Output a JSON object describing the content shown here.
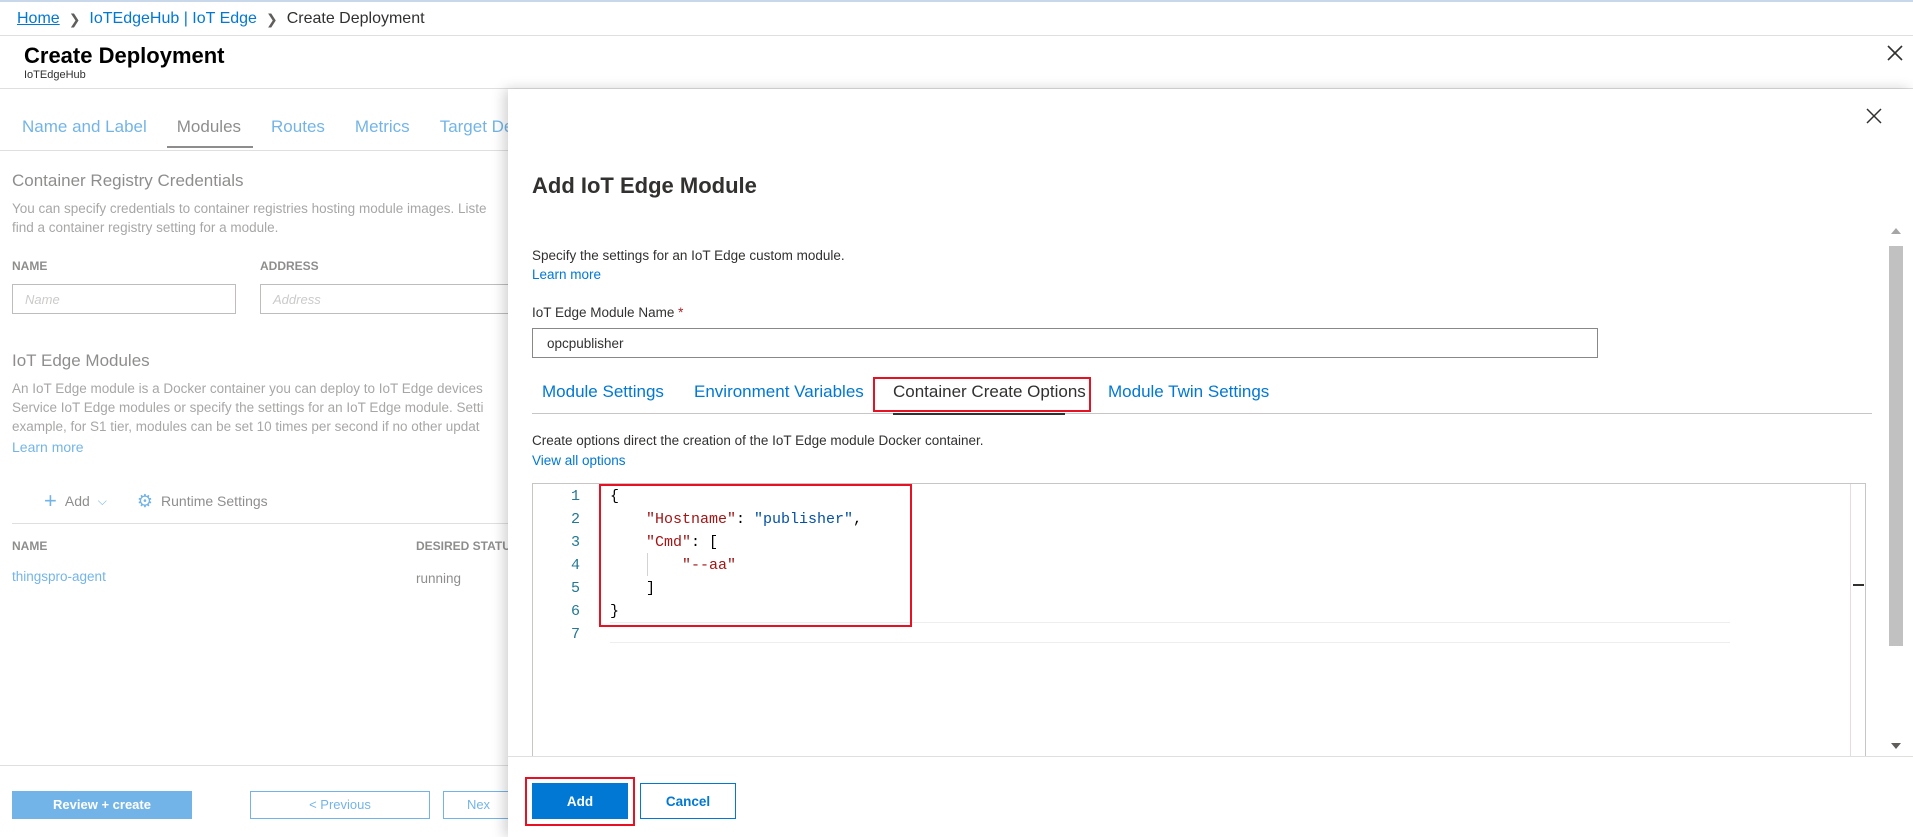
{
  "breadcrumb": {
    "home": "Home",
    "hub": "IoTEdgeHub | IoT Edge",
    "current": "Create Deployment"
  },
  "blade": {
    "title": "Create Deployment",
    "subtitle": "IoTEdgeHub"
  },
  "background": {
    "tabs": [
      "Name and Label",
      "Modules",
      "Routes",
      "Metrics",
      "Target De"
    ],
    "active_tab": "Modules",
    "registry": {
      "heading": "Container Registry Credentials",
      "desc_line1": "You can specify credentials to container registries hosting module images. Liste",
      "desc_line2": "find a container registry setting for a module.",
      "name_label": "NAME",
      "address_label": "ADDRESS",
      "name_placeholder": "Name",
      "address_placeholder": "Address"
    },
    "modules": {
      "heading": "IoT Edge Modules",
      "desc_line1": "An IoT Edge module is a Docker container you can deploy to IoT Edge devices",
      "desc_line2": "Service IoT Edge modules or specify the settings for an IoT Edge module. Setti",
      "desc_line3": "example, for S1 tier, modules can be set 10 times per second if no other updat",
      "learn_more": "Learn more",
      "add_label": "Add",
      "runtime_label": "Runtime Settings",
      "col_name": "NAME",
      "col_status": "DESIRED STATUS",
      "row_name": "thingspro-agent",
      "row_status": "running"
    },
    "footer": {
      "review": "Review + create",
      "previous": "< Previous",
      "next": "Nex"
    }
  },
  "panel": {
    "title": "Add IoT Edge Module",
    "description": "Specify the settings for an IoT Edge custom module.",
    "learn_more": "Learn more",
    "name_label": "IoT Edge Module Name",
    "required_mark": "*",
    "name_value": "opcpublisher",
    "tabs": [
      "Module Settings",
      "Environment Variables",
      "Container Create Options",
      "Module Twin Settings"
    ],
    "active_tab": "Container Create Options",
    "options_desc": "Create options direct the creation of the IoT Edge module Docker container.",
    "view_all": "View all options",
    "editor_lines": [
      {
        "n": "1",
        "tokens": [
          {
            "t": "{",
            "c": "p"
          }
        ]
      },
      {
        "n": "2",
        "tokens": [
          {
            "t": "    ",
            "c": "p"
          },
          {
            "t": "\"Hostname\"",
            "c": "key"
          },
          {
            "t": ": ",
            "c": "p"
          },
          {
            "t": "\"publisher\"",
            "c": "str"
          },
          {
            "t": ",",
            "c": "p"
          }
        ]
      },
      {
        "n": "3",
        "tokens": [
          {
            "t": "    ",
            "c": "p"
          },
          {
            "t": "\"Cmd\"",
            "c": "key"
          },
          {
            "t": ": [",
            "c": "p"
          }
        ]
      },
      {
        "n": "4",
        "tokens": [
          {
            "t": "        ",
            "c": "p"
          },
          {
            "t": "\"--aa\"",
            "c": "sstr"
          }
        ]
      },
      {
        "n": "5",
        "tokens": [
          {
            "t": "    ",
            "c": "p"
          },
          {
            "t": "]",
            "c": "p"
          }
        ]
      },
      {
        "n": "6",
        "tokens": [
          {
            "t": "}",
            "c": "p"
          }
        ]
      },
      {
        "n": "7",
        "tokens": []
      }
    ],
    "add_button": "Add",
    "cancel_button": "Cancel"
  },
  "colors": {
    "accent": "#0078d4",
    "highlight": "#e81123"
  },
  "icons": [
    "close-icon",
    "chevron-right-icon",
    "plus-icon",
    "chevron-down-icon",
    "gear-icon"
  ]
}
